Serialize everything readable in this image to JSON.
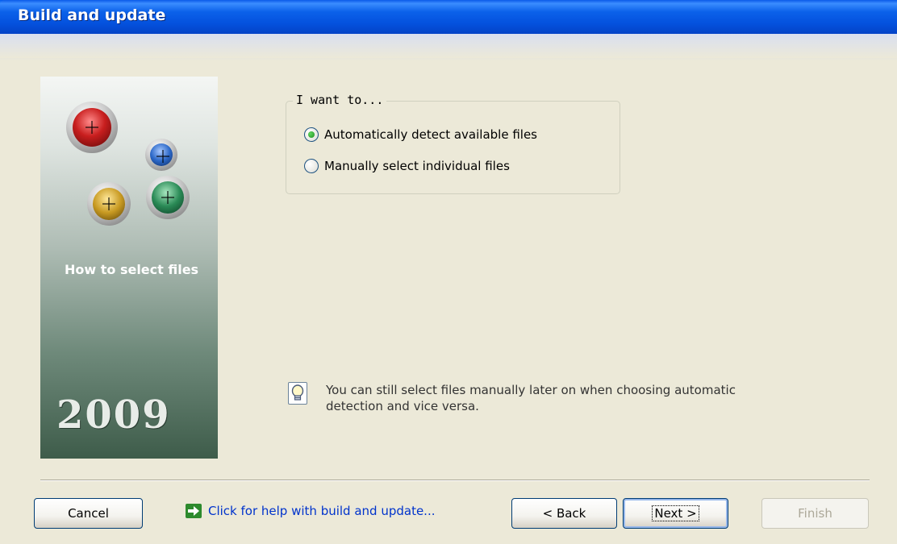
{
  "window": {
    "title": "Build and update"
  },
  "side_panel": {
    "label": "How to select files",
    "year": "2009"
  },
  "group": {
    "legend": "I want to...",
    "options": [
      {
        "label": "Automatically detect available files",
        "checked": true
      },
      {
        "label": "Manually select individual files",
        "checked": false
      }
    ]
  },
  "hint": {
    "text": "You can still select files manually later on when choosing automatic detection and vice versa."
  },
  "footer": {
    "cancel_label": "Cancel",
    "help_link": "Click for help with build and update...",
    "back_label": "< Back",
    "next_label": "Next >",
    "finish_label": "Finish"
  },
  "colors": {
    "title_bar": "#0451dd",
    "link": "#0033cc",
    "accent_green": "#2d8a2d"
  },
  "icons": [
    "orb-red-icon",
    "orb-blue-icon",
    "orb-yellow-icon",
    "orb-green-icon",
    "lightbulb-icon",
    "help-arrow-icon"
  ]
}
